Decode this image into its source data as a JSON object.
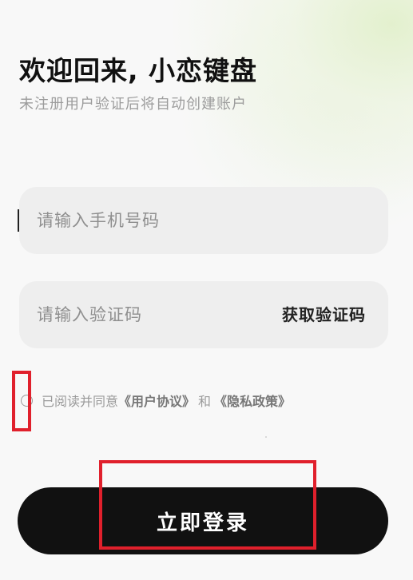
{
  "header": {
    "title": "欢迎回来, 小恋键盘",
    "subtitle": "未注册用户验证后将自动创建账户"
  },
  "form": {
    "phone_placeholder": "请输入手机号码",
    "phone_value": "",
    "code_placeholder": "请输入验证码",
    "code_value": "",
    "get_code_label": "获取验证码"
  },
  "agreement": {
    "checked": false,
    "prefix": "已阅读并同意",
    "user_agreement": "《用户协议》",
    "and": "和",
    "privacy_policy": "《隐私政策》"
  },
  "login_button": {
    "label": "立即登录"
  },
  "colors": {
    "background": "#f8f8f8",
    "accent_glow": "#e2f0cc",
    "button_bg": "#111111",
    "highlight": "#e0202c"
  }
}
